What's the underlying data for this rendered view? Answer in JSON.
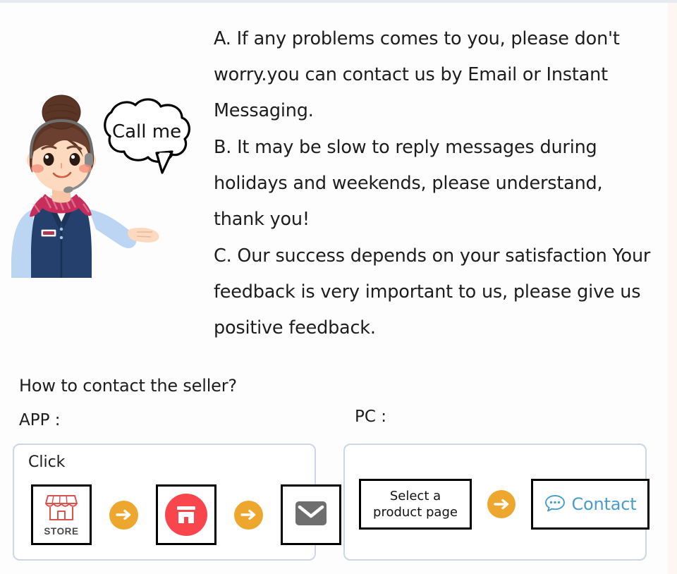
{
  "page": {
    "background": "#fefdfd",
    "accent_orange": "#eda72f",
    "accent_red": "#f9454c",
    "accent_blue": "#4a9ccc",
    "card_border": "#ccd6e4",
    "store_red": "#d9534f",
    "envelope_gray": "#6e6e6e"
  },
  "mascot": {
    "name": "customer-service-agent-illustration",
    "speech_bubble_text": "Call me",
    "hair_color": "#5b3526",
    "vest_color": "#26406e",
    "shirt_color": "#bad4f0",
    "scarf_color": "#c72e5c",
    "skin_color": "#fcd9bf"
  },
  "notes": {
    "paragraph_a": "A. If any problems comes to you, please don't worry.you can contact us by Email or Instant Messaging.",
    "paragraph_b": "B. It may be slow to reply messages during holidays and weekends, please understand, thank you!",
    "paragraph_c": "C. Our success depends on your satisfaction Your feedback is very important to us, please give us positive feedback."
  },
  "contact_section": {
    "heading": "How to contact the seller?",
    "app_label": "APP :",
    "pc_label": "PC :"
  },
  "app_card": {
    "click_label": "Click",
    "steps": [
      {
        "type": "icon",
        "icon": "storefront-outline-icon",
        "label": "STORE"
      },
      {
        "type": "arrow",
        "icon": "arrow-right-icon"
      },
      {
        "type": "icon",
        "icon": "shop-badge-icon",
        "label": ""
      },
      {
        "type": "arrow",
        "icon": "arrow-right-icon"
      },
      {
        "type": "icon",
        "icon": "envelope-icon",
        "label": ""
      }
    ]
  },
  "pc_card": {
    "steps": [
      {
        "type": "text",
        "line1": "Select a",
        "line2": "product page"
      },
      {
        "type": "arrow",
        "icon": "arrow-right-icon"
      },
      {
        "type": "button",
        "icon": "chat-bubble-icon",
        "label": "Contact"
      }
    ]
  }
}
